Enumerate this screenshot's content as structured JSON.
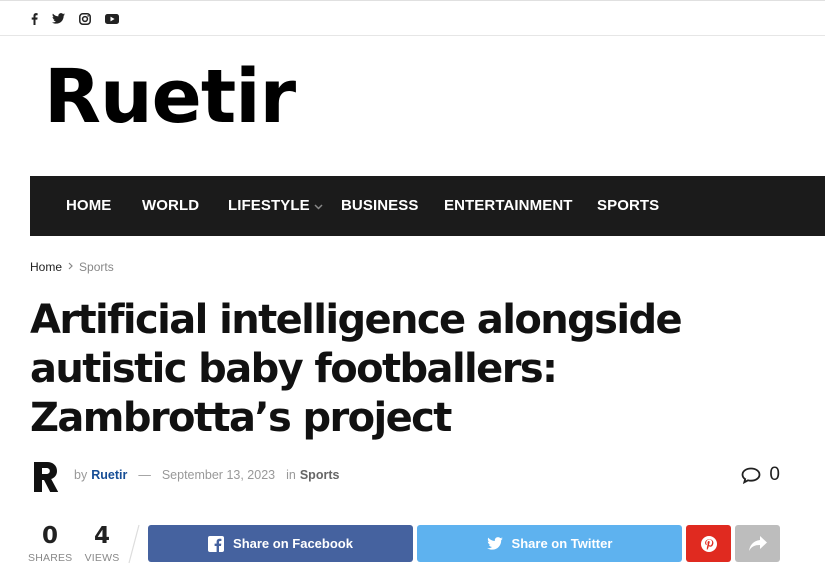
{
  "topbar": {
    "social": [
      {
        "icon": "facebook-icon"
      },
      {
        "icon": "twitter-icon"
      },
      {
        "icon": "instagram-icon"
      },
      {
        "icon": "youtube-icon"
      }
    ]
  },
  "site": {
    "logo_text": "Ruetir"
  },
  "nav": {
    "items": [
      {
        "label": "HOME"
      },
      {
        "label": "WORLD"
      },
      {
        "label": "LIFESTYLE",
        "has_dropdown": true
      },
      {
        "label": "BUSINESS"
      },
      {
        "label": "ENTERTAINMENT"
      },
      {
        "label": "SPORTS"
      }
    ]
  },
  "breadcrumb": {
    "home": "Home",
    "current": "Sports"
  },
  "article": {
    "title": "Artificial intelligence alongside autistic baby footballers: Zambrotta’s project",
    "by": "by",
    "author": "Ruetir",
    "dash": "—",
    "date": "September 13, 2023",
    "in": "in",
    "category": "Sports",
    "comments": "0"
  },
  "stats": {
    "shares": {
      "value": "0",
      "label": "SHARES"
    },
    "views": {
      "value": "4",
      "label": "VIEWS"
    }
  },
  "share": {
    "facebook_label": "Share on Facebook",
    "twitter_label": "Share on Twitter"
  },
  "colors": {
    "nav_bg": "#1b1b1b",
    "author_link": "#174e96",
    "facebook": "#45629f",
    "twitter": "#5eb2ef",
    "pinterest": "#e02a20",
    "more": "#bdbdbd"
  }
}
